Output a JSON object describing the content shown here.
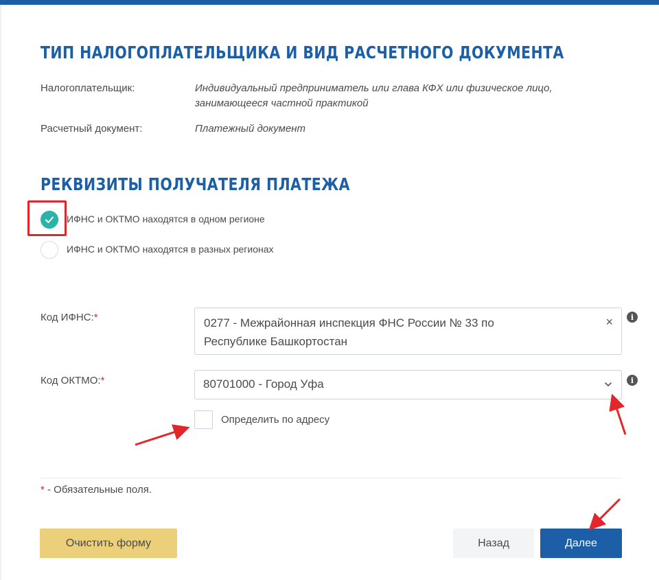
{
  "section1": {
    "title": "ТИП НАЛОГОПЛАТЕЛЬЩИКА И ВИД РАСЧЕТНОГО ДОКУМЕНТА",
    "taxpayer_label": "Налогоплательщик:",
    "taxpayer_value_line1": "Индивидуальный предприниматель или глава КФХ или физическое лицо,",
    "taxpayer_value_line2": "занимающееся частной практикой",
    "doc_label": "Расчетный документ:",
    "doc_value": "Платежный документ"
  },
  "section2": {
    "title": "РЕКВИЗИТЫ ПОЛУЧАТЕЛЯ ПЛАТЕЖА",
    "radio_same": "ИФНС и ОКТМО находятся в одном регионе",
    "radio_diff": "ИФНС и ОКТМО находятся в разных регионах",
    "selected_radio": "same"
  },
  "fields": {
    "ifns_label": "Код ИФНС:",
    "ifns_value_line1": "0277 - Межрайонная инспекция ФНС России № 33 по",
    "ifns_value_line2": "Республике Башкортостан",
    "clear_symbol": "×",
    "oktmo_label": "Код ОКТМО:",
    "oktmo_value": "80701000 - Город Уфа",
    "required_mark": "*",
    "info_symbol": "i",
    "by_address_label": "Определить по адресу",
    "by_address_checked": false
  },
  "footnote": {
    "mark": "*",
    "text": " - Обязательные поля."
  },
  "buttons": {
    "clear": "Очистить форму",
    "back": "Назад",
    "next": "Далее"
  },
  "colors": {
    "brand_blue": "#1d5fa6",
    "teal_check": "#2bb3a8",
    "annotation_red": "#e2262a",
    "clear_button": "#eccf7a"
  },
  "icons": {
    "check": "check-icon",
    "info": "info-icon",
    "clear": "close-icon",
    "dropdown": "chevron-down-icon",
    "annotation": "arrow-annotation"
  }
}
